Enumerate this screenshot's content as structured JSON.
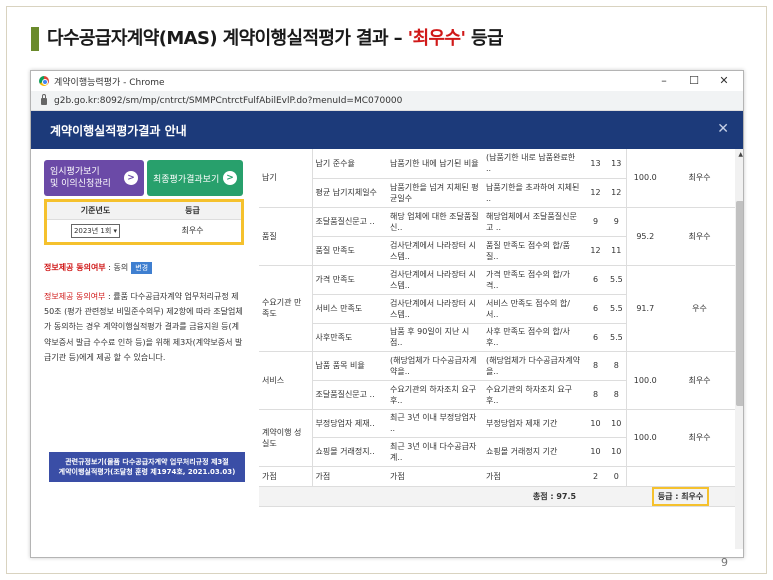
{
  "slide": {
    "title_prefix": "다수공급자계약(MAS) 계약이행실적평가 결과 – ",
    "title_highlight": "'최우수'",
    "title_suffix": " 등급",
    "page_number": "9"
  },
  "browser": {
    "window_title": "계약이행능력평가 - Chrome",
    "url": "g2b.go.kr:8092/sm/mp/cntrct/SMMPCntrctFulfAbilEvlP.do?menuId=MC070000",
    "minimize": "–",
    "maximize": "☐",
    "close": "✕"
  },
  "app": {
    "header_title": "계약이행실적평가결과 안내",
    "close_symbol": "✕",
    "buttons": {
      "temp_eval_line1": "임시평가보기",
      "temp_eval_line2": "및 이의신청관리",
      "final_eval": "최종평가결과보기",
      "arrow": ">"
    },
    "year_table": {
      "col_year": "기준년도",
      "col_grade": "등급",
      "year_value": "2023년 1회",
      "grade_value": "최우수"
    },
    "consent": {
      "label": "정보제공 동의여부",
      "separator": " : ",
      "value": "동의",
      "change_button": "변경"
    },
    "consent_desc": {
      "label": "정보제공 동의여부",
      "text": " : 률품 다수공급자계약 업무처리규정 제50조 (평가 관련정보 비밀준수의무) 제2항에 따라 조달업체가 동의하는 경우 계약이행실적평가 결과를 금융지원 등(계약보증서 발급 수수료 인하 등)을 위해 제3자(계약보증서 발급기관 등)에게 제공 할 수 있습니다."
    },
    "law_button_line1": "관련규정보기(물품 다수공급자계약 업무처리규정 제3절",
    "law_button_line2": "계약이행실적평가(조달청 훈령 제1974호, 2021.03.03)"
  },
  "results": {
    "groups": [
      {
        "category": "납기",
        "subtotal": "100.0",
        "grade": "최우수",
        "items": [
          {
            "name": "납기 준수율",
            "criteria": "납품기한 내에 납기된 비율",
            "method": "(납품기한 내로 납품완료한 ..",
            "max": "13",
            "score": "13"
          },
          {
            "name": "평균 납기지체일수",
            "criteria": "납품기한을 넘겨 지체된 평균일수",
            "method": "납품기한을 초과하여 지체된 ..",
            "max": "12",
            "score": "12"
          }
        ]
      },
      {
        "category": "품질",
        "subtotal": "95.2",
        "grade": "최우수",
        "items": [
          {
            "name": "조달품질신문고 ..",
            "criteria": "해당 업체에 대한 조달품질신..",
            "method": "해당업체에서 조달품질신문고 ..",
            "max": "9",
            "score": "9"
          },
          {
            "name": "품질 만족도",
            "criteria": "검사단계에서 나라장터 시스템..",
            "method": "품질 만족도 점수의 합/품질..",
            "max": "12",
            "score": "11"
          }
        ]
      },
      {
        "category": "수요기관 만족도",
        "subtotal": "91.7",
        "grade": "우수",
        "items": [
          {
            "name": "가격 만족도",
            "criteria": "검사단계에서 나라장터 시스템..",
            "method": "가격 만족도 점수의 합/가격..",
            "max": "6",
            "score": "5.5"
          },
          {
            "name": "서비스 만족도",
            "criteria": "검사단계에서 나라장터 시스템..",
            "method": "서비스 만족도 점수의 합/서..",
            "max": "6",
            "score": "5.5"
          },
          {
            "name": "사후만족도",
            "criteria": "납품 후 90일이 지난 시점..",
            "method": "사후 만족도 점수의 합/사후..",
            "max": "6",
            "score": "5.5"
          }
        ]
      },
      {
        "category": "서비스",
        "subtotal": "100.0",
        "grade": "최우수",
        "items": [
          {
            "name": "납품 품목 비율",
            "criteria": "(해당업체가 다수공급자계약을..",
            "method": "(해당업체가 다수공급자계약을..",
            "max": "8",
            "score": "8"
          },
          {
            "name": "조달품질신문고 ..",
            "criteria": "수요기관의 하자조치 요구후..",
            "method": "수요기관의 하자조치 요구후..",
            "max": "8",
            "score": "8"
          }
        ]
      },
      {
        "category": "계약이행 성실도",
        "subtotal": "100.0",
        "grade": "최우수",
        "items": [
          {
            "name": "부정당업자 제재..",
            "criteria": "최근 3년 이내 부정당업자 ..",
            "method": "부정당업자 제재 기간",
            "max": "10",
            "score": "10"
          },
          {
            "name": "쇼핑몰 거래정지..",
            "criteria": "최근 3년 이내 다수공급자계..",
            "method": "쇼핑몰 거래정지 기간",
            "max": "10",
            "score": "10"
          }
        ]
      }
    ],
    "bonus": {
      "category": "가점",
      "name": "가점",
      "criteria": "가점",
      "method": "가점",
      "max": "2",
      "score": "0"
    },
    "total_label": "총점 : 97.5",
    "grade_label": "등급 : 최우수"
  }
}
